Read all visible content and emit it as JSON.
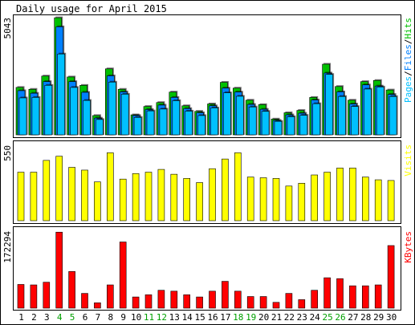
{
  "chart_data": [
    {
      "type": "bar",
      "title": "Daily usage for April 2015",
      "ylabel_top_value": "5043",
      "legend": [
        "Pages",
        "/",
        "Files",
        "/",
        "Hits"
      ],
      "colors": {
        "Hits": "#00c000",
        "Files": "#0080ff",
        "Pages": "#00c0ff",
        "legend_pages": "#00c0ff",
        "legend_files": "#0080ff",
        "legend_hits": "#00c000",
        "sep": "#000000"
      },
      "ylim": [
        0,
        5043
      ],
      "categories": [
        "1",
        "2",
        "3",
        "4",
        "5",
        "6",
        "7",
        "8",
        "9",
        "10",
        "11",
        "12",
        "13",
        "14",
        "15",
        "16",
        "17",
        "18",
        "19",
        "20",
        "21",
        "22",
        "23",
        "24",
        "25",
        "26",
        "27",
        "28",
        "29",
        "30"
      ],
      "weekend_days": [
        "4",
        "5",
        "11",
        "12",
        "18",
        "19",
        "25",
        "26"
      ],
      "series": [
        {
          "name": "Hits",
          "values": [
            2040,
            1960,
            2530,
            5040,
            2490,
            2130,
            830,
            2840,
            1960,
            860,
            1220,
            1390,
            1840,
            1250,
            1010,
            1330,
            2260,
            2010,
            1490,
            1300,
            680,
            950,
            1050,
            1610,
            3040,
            2080,
            1490,
            2290,
            2340,
            1930
          ]
        },
        {
          "name": "Files",
          "values": [
            1900,
            1790,
            2290,
            4650,
            2290,
            1830,
            720,
            2540,
            1850,
            830,
            1090,
            1280,
            1610,
            1130,
            950,
            1250,
            2010,
            1840,
            1310,
            1100,
            620,
            860,
            930,
            1500,
            2660,
            1850,
            1330,
            2150,
            2100,
            1740
          ]
        },
        {
          "name": "Pages",
          "values": [
            1590,
            1610,
            2130,
            3480,
            2040,
            1480,
            660,
            2270,
            1750,
            750,
            1030,
            1110,
            1470,
            1020,
            830,
            1160,
            1810,
            1660,
            1200,
            1010,
            580,
            780,
            840,
            1340,
            2600,
            1650,
            1220,
            1970,
            2060,
            1650
          ]
        }
      ]
    },
    {
      "type": "bar",
      "ylabel_top_value": "550",
      "legend": "Visits",
      "color": "#ffff00",
      "ylim": [
        0,
        550
      ],
      "categories": [
        "1",
        "2",
        "3",
        "4",
        "5",
        "6",
        "7",
        "8",
        "9",
        "10",
        "11",
        "12",
        "13",
        "14",
        "15",
        "16",
        "17",
        "18",
        "19",
        "20",
        "21",
        "22",
        "23",
        "24",
        "25",
        "26",
        "27",
        "28",
        "29",
        "30"
      ],
      "series": [
        {
          "name": "Visits",
          "values": [
            350,
            350,
            435,
            465,
            385,
            365,
            280,
            490,
            300,
            340,
            350,
            370,
            335,
            305,
            275,
            375,
            445,
            490,
            315,
            310,
            305,
            250,
            270,
            330,
            350,
            380,
            380,
            315,
            295,
            290
          ]
        }
      ]
    },
    {
      "type": "bar",
      "ylabel_top_value": "172294",
      "legend": "KBytes",
      "color": "#ff0000",
      "ylim": [
        0,
        172294
      ],
      "categories": [
        "1",
        "2",
        "3",
        "4",
        "5",
        "6",
        "7",
        "8",
        "9",
        "10",
        "11",
        "12",
        "13",
        "14",
        "15",
        "16",
        "17",
        "18",
        "19",
        "20",
        "21",
        "22",
        "23",
        "24",
        "25",
        "26",
        "27",
        "28",
        "29",
        "30"
      ],
      "series": [
        {
          "name": "KBytes",
          "values": [
            53000,
            52000,
            58000,
            170000,
            82000,
            33000,
            12000,
            52000,
            148000,
            25000,
            30000,
            40000,
            38000,
            30000,
            25000,
            38000,
            60000,
            38000,
            26000,
            26000,
            13000,
            33000,
            19000,
            40000,
            68000,
            66000,
            50000,
            50000,
            52000,
            140000
          ]
        }
      ]
    }
  ]
}
